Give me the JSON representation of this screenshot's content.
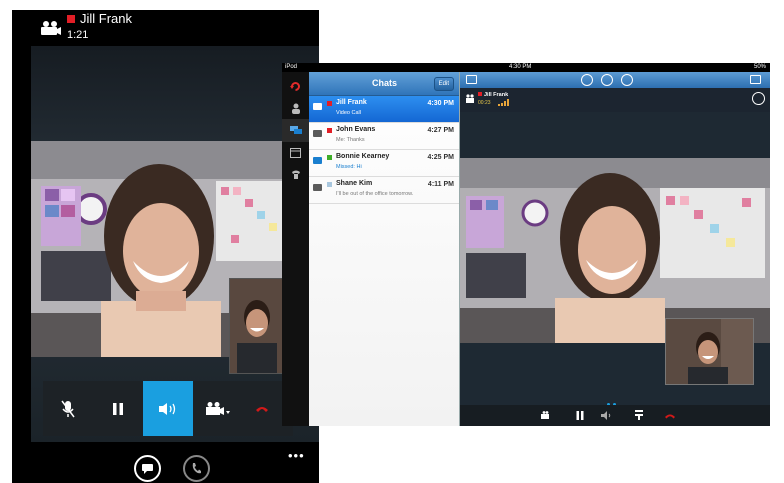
{
  "phone": {
    "contact_name": "Jill Frank",
    "call_duration": "1:21",
    "presence_color": "#e21e26",
    "accent_color": "#1a9fe0",
    "controls": [
      {
        "name": "mute-button",
        "icon": "microphone-off-icon"
      },
      {
        "name": "hold-button",
        "icon": "pause-icon"
      },
      {
        "name": "speaker-button",
        "icon": "speaker-icon",
        "active": true
      },
      {
        "name": "video-options-button",
        "icon": "video-camera-icon"
      },
      {
        "name": "end-call-button",
        "icon": "hang-up-icon"
      }
    ],
    "bottom_actions": [
      "chat-icon",
      "phone-icon"
    ],
    "more_label": "•••"
  },
  "ipad": {
    "status": {
      "device": "iPod",
      "time": "4:30 PM",
      "battery": "50%"
    },
    "rail": [
      "refresh-icon",
      "contacts-icon",
      "chats-icon",
      "calendar-icon",
      "phone-icon"
    ],
    "chats": {
      "title": "Chats",
      "edit_label": "Edit",
      "items": [
        {
          "name": "Jill Frank",
          "preview": "Video Call",
          "time": "4:30 PM",
          "presence": "#e21e26",
          "selected": true
        },
        {
          "name": "John Evans",
          "preview": "Me: Thanks",
          "time": "4:27 PM",
          "presence": "#e21e26",
          "selected": false
        },
        {
          "name": "Bonnie Kearney",
          "preview": "Missed: Hi",
          "time": "4:25 PM",
          "presence": "#3fae29",
          "selected": false
        },
        {
          "name": "Shane Kim",
          "preview": "I'll be out of the office tomorrow.",
          "time": "4:11 PM",
          "presence": "#a9c7de",
          "selected": false
        }
      ]
    },
    "call": {
      "contact_name": "Jill Frank",
      "call_duration": "00:23"
    }
  }
}
